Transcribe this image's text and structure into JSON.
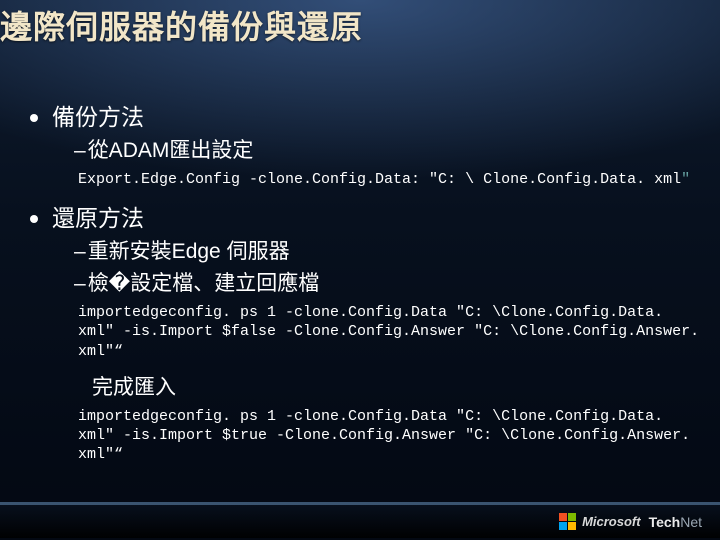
{
  "title": "邊際伺服器的備份與還原",
  "sections": [
    {
      "heading": "備份方法"
    },
    {
      "sub": "從ADAM匯出設定"
    },
    {
      "code_plain": "Export.Edge.Config -clone.Config.Data: \"C: \\ Clone.Config.Data. xml",
      "code_tail": "\""
    },
    {
      "heading": "還原方法"
    },
    {
      "sub": "重新安裝Edge 伺服器"
    },
    {
      "sub": "檢�設定檔、建立回應檔"
    },
    {
      "code_plain": "importedgeconfig. ps 1 -clone.Config.Data \"C: \\Clone.Config.Data. xml\" -is.Import $false -Clone.Config.Answer \"C: \\Clone.Config.Answer. xml\"“"
    },
    {
      "subhead": "完成匯入"
    },
    {
      "code_plain": "importedgeconfig. ps 1 -clone.Config.Data \"C: \\Clone.Config.Data. xml\" -is.Import $true -Clone.Config.Answer \"C: \\Clone.Config.Answer. xml\"“"
    }
  ],
  "footer": {
    "brand": "Microsoft",
    "product_a": "Tech",
    "product_b": "Net"
  }
}
